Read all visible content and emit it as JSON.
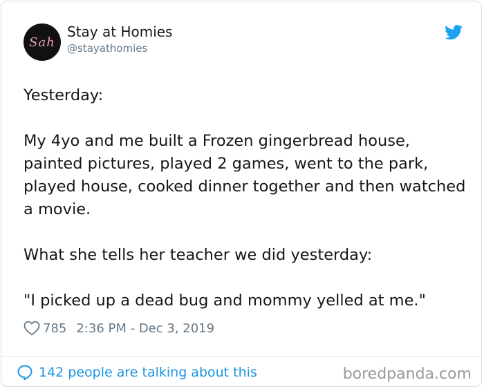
{
  "author": {
    "avatar_text": "Sah",
    "display_name": "Stay at Homies",
    "handle": "@stayathomies"
  },
  "tweet": {
    "paragraphs": [
      "Yesterday:",
      "My 4yo and me built a Frozen gingerbread house, painted pictures, played 2 games, went to the park, played house, cooked dinner together and then watched a movie.",
      "What she tells her teacher we did yesterday:",
      "\"I picked up a dead bug and mommy yelled at me.\""
    ],
    "likes": "785",
    "timestamp": "2:36 PM - Dec 3, 2019"
  },
  "footer": {
    "talking_text": "142 people are talking about this",
    "watermark": "boredpanda.com"
  },
  "icons": {
    "brand": "twitter-bird-icon",
    "like": "heart-icon",
    "comment": "comment-bubble-icon"
  },
  "colors": {
    "twitter_blue": "#1da1f2",
    "link_blue": "#1b95e0",
    "secondary_text": "#657786",
    "avatar_bg": "#111111",
    "avatar_text": "#e8a0b8"
  }
}
